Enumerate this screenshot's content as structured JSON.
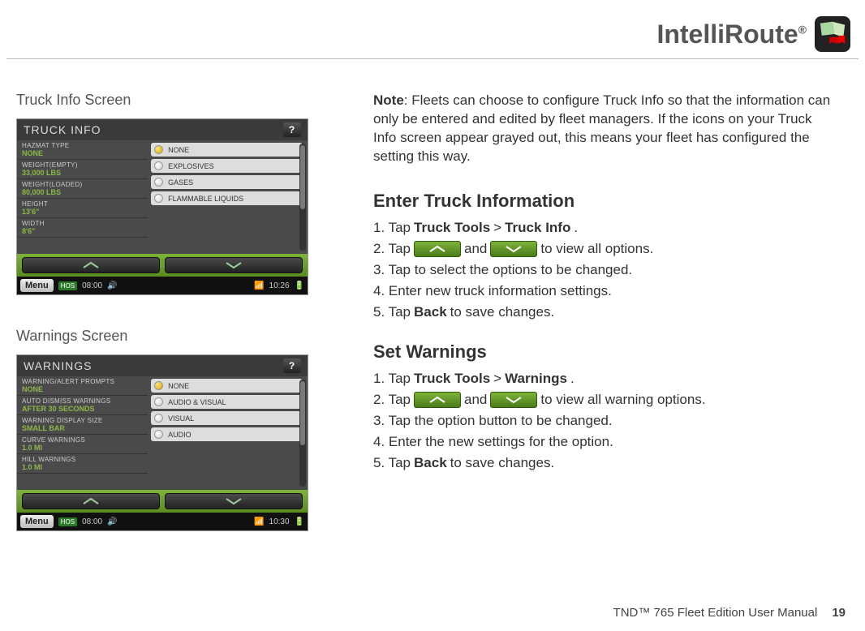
{
  "header": {
    "title": "IntelliRoute",
    "reg": "®"
  },
  "left": {
    "caption1": "Truck Info Screen",
    "caption2": "Warnings Screen",
    "truck": {
      "title": "TRUCK INFO",
      "rows": [
        {
          "lbl": "HAZMAT TYPE",
          "val": "NONE"
        },
        {
          "lbl": "WEIGHT(EMPTY)",
          "val": "33,000 LBS"
        },
        {
          "lbl": "WEIGHT(LOADED)",
          "val": "80,000 LBS"
        },
        {
          "lbl": "HEIGHT",
          "val": "13'6\""
        },
        {
          "lbl": "WIDTH",
          "val": "8'6\""
        }
      ],
      "options": [
        "NONE",
        "EXPLOSIVES",
        "GASES",
        "FLAMMABLE LIQUIDS"
      ],
      "menu": "Menu",
      "time_left": "08:00",
      "time_right": "10:26"
    },
    "warnings": {
      "title": "WARNINGS",
      "rows": [
        {
          "lbl": "WARNING/ALERT PROMPTS",
          "val": "NONE"
        },
        {
          "lbl": "AUTO DISMISS WARNINGS",
          "val": "AFTER 30 SECONDS"
        },
        {
          "lbl": "WARNING DISPLAY SIZE",
          "val": "SMALL BAR"
        },
        {
          "lbl": "CURVE WARNINGS",
          "val": "1.0 MI"
        },
        {
          "lbl": "HILL WARNINGS",
          "val": "1.0 MI"
        }
      ],
      "options": [
        "NONE",
        "AUDIO & VISUAL",
        "VISUAL",
        "AUDIO"
      ],
      "menu": "Menu",
      "time_left": "08:00",
      "time_right": "10:30"
    },
    "hos": "HOS"
  },
  "right": {
    "note_label": "Note",
    "note_text": ": Fleets can choose to configure Truck Info so that the information can only be entered and edited by fleet managers. If the icons on your Truck Info screen appear grayed out, this means your fleet has configured the setting this way.",
    "h1": "Enter Truck Information",
    "steps1": [
      {
        "pre": "1. Tap ",
        "b1": "Truck Tools",
        "mid": " > ",
        "b2": "Truck Info",
        "post": "."
      },
      {
        "pre": "2. Tap ",
        "btn": "up",
        "mid": " and ",
        "btn2": "down",
        "post": " to view all options."
      },
      {
        "pre": "3. Tap to select the options to be changed."
      },
      {
        "pre": "4. Enter new truck information settings."
      },
      {
        "pre": "5. Tap ",
        "b1": "Back",
        "post": " to save changes."
      }
    ],
    "h2": "Set Warnings",
    "steps2": [
      {
        "pre": "1. Tap ",
        "b1": "Truck Tools",
        "mid": " > ",
        "b2": "Warnings",
        "post": "."
      },
      {
        "pre": "2. Tap",
        "btn": "up",
        "mid": " and",
        "btn2": "down",
        "post": " to view all warning options."
      },
      {
        "pre": "3. Tap the option button to be changed."
      },
      {
        "pre": "4. Enter the new settings for the option."
      },
      {
        "pre": "5. Tap ",
        "b1": "Back",
        "post": " to save changes."
      }
    ]
  },
  "footer": {
    "text": "TND™ 765 Fleet Edition User Manual",
    "page": "19"
  }
}
